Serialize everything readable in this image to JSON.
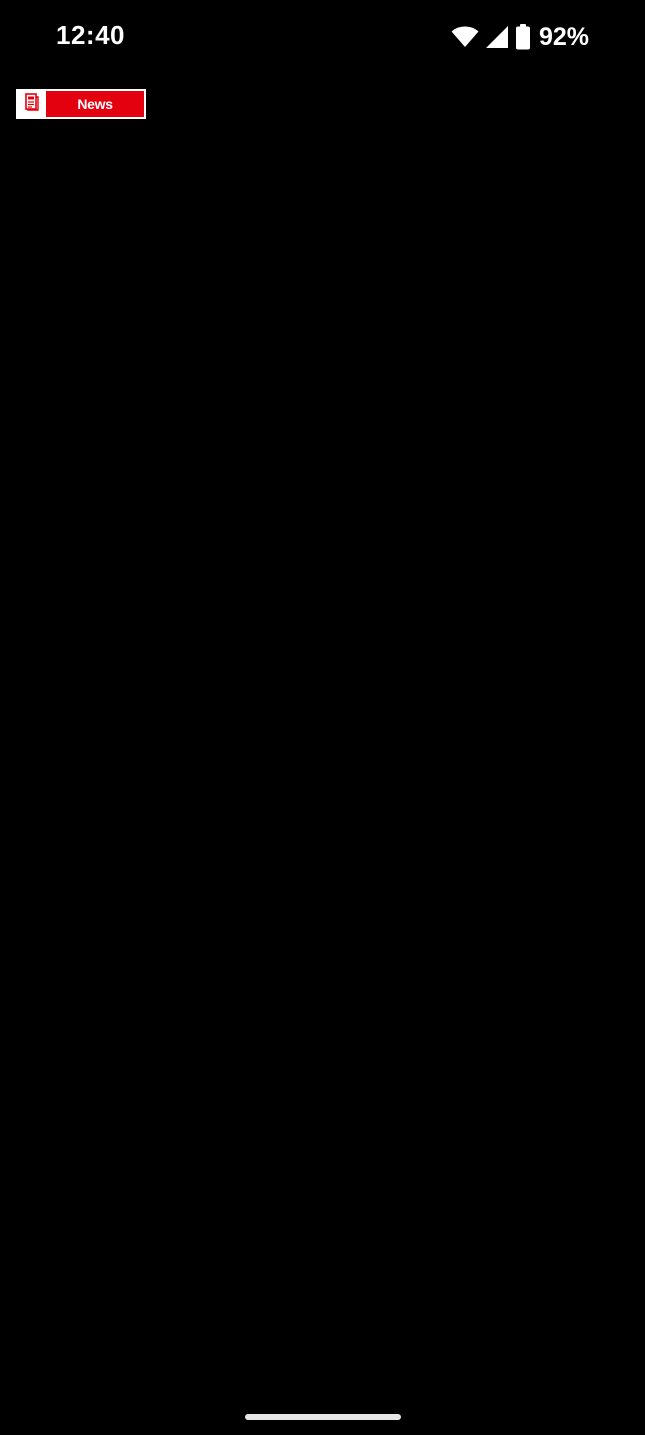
{
  "status_bar": {
    "time": "12:40",
    "battery_percent": "92%",
    "wifi_icon": "wifi-icon",
    "signal_icon": "cell-signal-icon",
    "battery_icon": "battery-icon",
    "battery_level": 0.92
  },
  "widget": {
    "label": "News",
    "icon": "newspaper-icon",
    "accent_color": "#e3000f"
  },
  "navigation": {
    "home_indicator": "home-indicator"
  }
}
